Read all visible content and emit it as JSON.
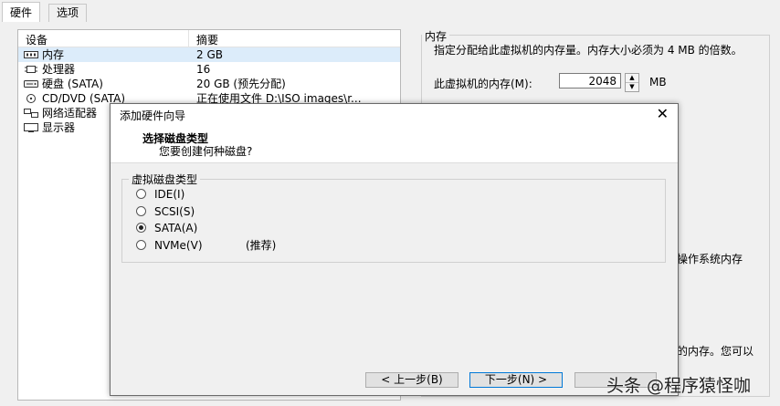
{
  "tabs": [
    "硬件",
    "选项"
  ],
  "device_list": {
    "col_device": "设备",
    "col_summary": "摘要",
    "rows": [
      {
        "name": "内存",
        "summary": "2 GB",
        "icon": "memory-icon"
      },
      {
        "name": "处理器",
        "summary": "16",
        "icon": "cpu-icon"
      },
      {
        "name": "硬盘 (SATA)",
        "summary": "20 GB (预先分配)",
        "icon": "disk-icon"
      },
      {
        "name": "CD/DVD (SATA)",
        "summary": "正在使用文件 D:\\ISO images\\r...",
        "icon": "cd-icon"
      },
      {
        "name": "网络适配器",
        "summary": "",
        "icon": "network-icon"
      },
      {
        "name": "显示器",
        "summary": "",
        "icon": "monitor-icon"
      }
    ]
  },
  "memory_panel": {
    "title": "内存",
    "description": "指定分配给此虚拟机的内存量。内存大小必须为 4 MB 的倍数。",
    "label": "此虚拟机的内存(M):",
    "value": "2048",
    "unit": "MB",
    "partial_text_1": "操作系统内存",
    "partial_text_2": "的内存。您可以"
  },
  "dialog": {
    "title": "添加硬件向导",
    "heading": "选择磁盘类型",
    "subheading": "您要创建何种磁盘?",
    "group_title": "虚拟磁盘类型",
    "options": [
      {
        "label": "IDE(I)",
        "note": "",
        "checked": false
      },
      {
        "label": "SCSI(S)",
        "note": "",
        "checked": false
      },
      {
        "label": "SATA(A)",
        "note": "",
        "checked": true
      },
      {
        "label": "NVMe(V)",
        "note": "(推荐)",
        "checked": false
      }
    ],
    "buttons": {
      "back": "< 上一步(B)",
      "next": "下一步(N) >"
    }
  },
  "watermark": "头条 @程序猿怪咖"
}
